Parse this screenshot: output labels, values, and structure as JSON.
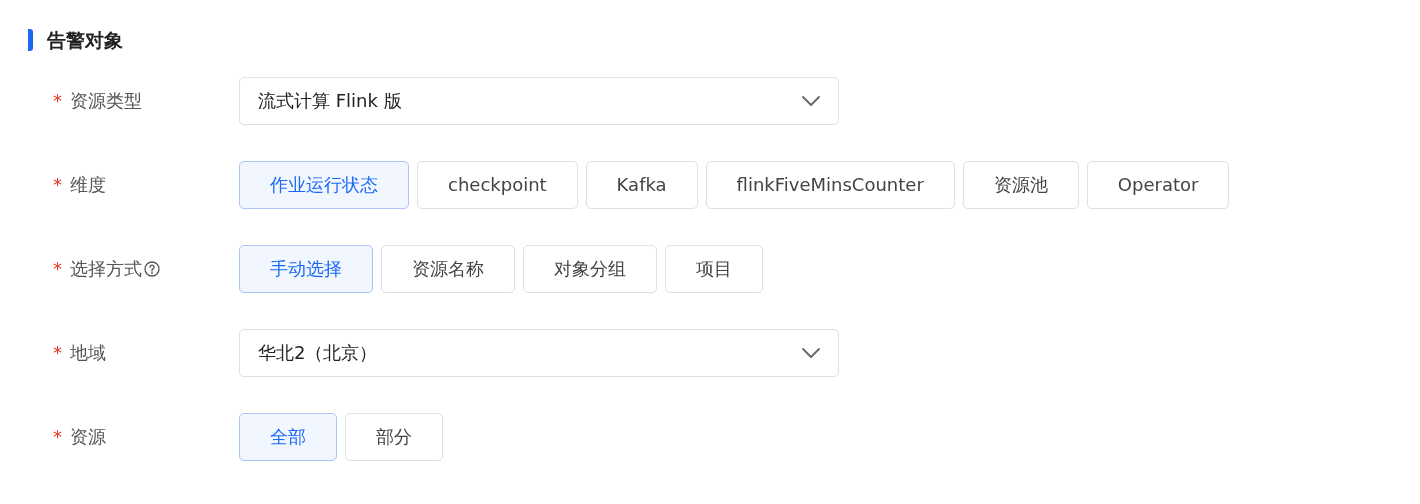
{
  "section": {
    "title": "告警对象"
  },
  "fields": [
    {
      "kind": "select",
      "required_mark": "*",
      "label": "资源类型",
      "help": false,
      "value": "流式计算 Flink 版"
    },
    {
      "kind": "options",
      "required_mark": "*",
      "label": "维度",
      "help": false,
      "options": [
        {
          "label": "作业运行状态",
          "selected": true
        },
        {
          "label": "checkpoint",
          "selected": false
        },
        {
          "label": "Kafka",
          "selected": false
        },
        {
          "label": "flinkFiveMinsCounter",
          "selected": false
        },
        {
          "label": "资源池",
          "selected": false
        },
        {
          "label": "Operator",
          "selected": false
        }
      ]
    },
    {
      "kind": "options",
      "required_mark": "*",
      "label": "选择方式",
      "help": true,
      "options": [
        {
          "label": "手动选择",
          "selected": true
        },
        {
          "label": "资源名称",
          "selected": false
        },
        {
          "label": "对象分组",
          "selected": false
        },
        {
          "label": "项目",
          "selected": false
        }
      ]
    },
    {
      "kind": "select",
      "required_mark": "*",
      "label": "地域",
      "help": false,
      "value": "华北2（北京）"
    },
    {
      "kind": "options",
      "required_mark": "*",
      "label": "资源",
      "help": false,
      "options": [
        {
          "label": "全部",
          "selected": true
        },
        {
          "label": "部分",
          "selected": false
        }
      ]
    }
  ]
}
